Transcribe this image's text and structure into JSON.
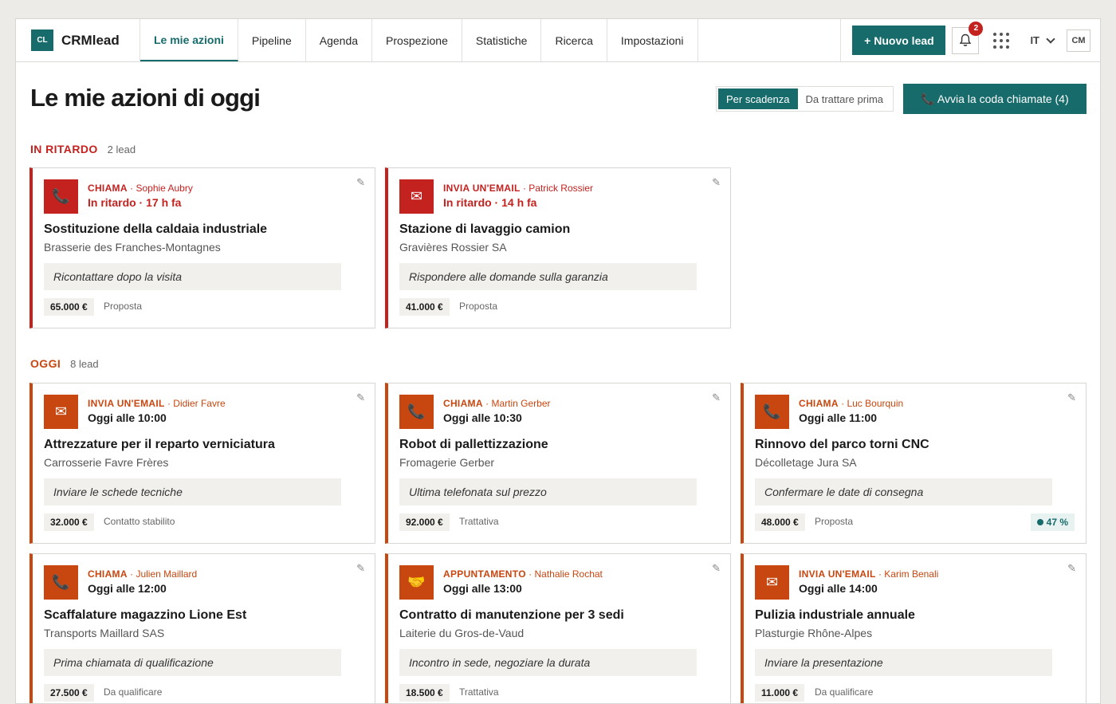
{
  "brand": {
    "logo": "CL",
    "name": "CRMlead"
  },
  "nav": [
    {
      "label": "Le mie azioni",
      "active": true
    },
    {
      "label": "Pipeline"
    },
    {
      "label": "Agenda"
    },
    {
      "label": "Prospezione"
    },
    {
      "label": "Statistiche"
    },
    {
      "label": "Ricerca"
    },
    {
      "label": "Impostazioni"
    }
  ],
  "topbar": {
    "new_lead": "+ Nuovo lead",
    "notifications_count": "2",
    "lang": "IT",
    "avatar": "CM"
  },
  "page": {
    "title": "Le mie azioni di oggi",
    "sort_options": [
      "Per scadenza",
      "Da trattare prima"
    ],
    "queue_button": "📞 Avvia la coda chiamate (4)"
  },
  "sections": {
    "late": {
      "title": "IN RITARDO",
      "count": "2 lead",
      "cards": [
        {
          "icon": "phone-icon",
          "glyph": "📞",
          "type": "CHIAMA",
          "contact": " · Sophie Aubry",
          "when": "In ritardo · 17 h fa",
          "title": "Sostituzione della caldaia industriale",
          "company": "Brasserie des Franches-Montagnes",
          "note": "Ricontattare dopo la visita",
          "amount": "65.000 €",
          "stage": "Proposta"
        },
        {
          "icon": "email-icon",
          "glyph": "✉",
          "type": "INVIA UN'EMAIL",
          "contact": " · Patrick Rossier",
          "when": "In ritardo · 14 h fa",
          "title": "Stazione di lavaggio camion",
          "company": "Gravières Rossier SA",
          "note": "Rispondere alle domande sulla garanzia",
          "amount": "41.000 €",
          "stage": "Proposta"
        }
      ]
    },
    "today": {
      "title": "OGGI",
      "count": "8 lead",
      "cards": [
        {
          "icon": "email-icon",
          "glyph": "✉",
          "type": "INVIA UN'EMAIL",
          "contact": " · Didier Favre",
          "when": "Oggi alle 10:00",
          "title": "Attrezzature per il reparto verniciatura",
          "company": "Carrosserie Favre Frères",
          "note": "Inviare le schede tecniche",
          "amount": "32.000 €",
          "stage": "Contatto stabilito"
        },
        {
          "icon": "phone-icon",
          "glyph": "📞",
          "type": "CHIAMA",
          "contact": " · Martin Gerber",
          "when": "Oggi alle 10:30",
          "title": "Robot di pallettizzazione",
          "company": "Fromagerie Gerber",
          "note": "Ultima telefonata sul prezzo",
          "amount": "92.000 €",
          "stage": "Trattativa"
        },
        {
          "icon": "phone-icon",
          "glyph": "📞",
          "type": "CHIAMA",
          "contact": " · Luc Bourquin",
          "when": "Oggi alle 11:00",
          "title": "Rinnovo del parco torni CNC",
          "company": "Décolletage Jura SA",
          "note": "Confermare le date di consegna",
          "amount": "48.000 €",
          "stage": "Proposta",
          "probability": "47 %"
        },
        {
          "icon": "phone-icon",
          "glyph": "📞",
          "type": "CHIAMA",
          "contact": " · Julien Maillard",
          "when": "Oggi alle 12:00",
          "title": "Scaffalature magazzino Lione Est",
          "company": "Transports Maillard SAS",
          "note": "Prima chiamata di qualificazione",
          "amount": "27.500 €",
          "stage": "Da qualificare"
        },
        {
          "icon": "handshake-icon",
          "glyph": "🤝",
          "type": "APPUNTAMENTO",
          "contact": " · Nathalie Rochat",
          "when": "Oggi alle 13:00",
          "title": "Contratto di manutenzione per 3 sedi",
          "company": "Laiterie du Gros-de-Vaud",
          "note": "Incontro in sede, negoziare la durata",
          "amount": "18.500 €",
          "stage": "Trattativa"
        },
        {
          "icon": "email-icon",
          "glyph": "✉",
          "type": "INVIA UN'EMAIL",
          "contact": " · Karim Benali",
          "when": "Oggi alle 14:00",
          "title": "Pulizia industriale annuale",
          "company": "Plasturgie Rhône-Alpes",
          "note": "Inviare la presentazione",
          "amount": "11.000 €",
          "stage": "Da qualificare"
        }
      ]
    }
  },
  "colors": {
    "accent": "#176b6b",
    "late": "#c4221f",
    "today": "#c8460f"
  }
}
